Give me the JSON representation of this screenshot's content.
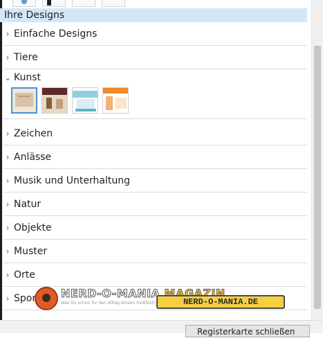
{
  "section": {
    "title": "Ihre Designs"
  },
  "categories": [
    {
      "label": "Einfache Designs"
    },
    {
      "label": "Tiere"
    },
    {
      "label": "Kunst"
    },
    {
      "label": "Zeichen"
    },
    {
      "label": "Anlässe"
    },
    {
      "label": "Musik und Unterhaltung"
    },
    {
      "label": "Natur"
    },
    {
      "label": "Objekte"
    },
    {
      "label": "Muster"
    },
    {
      "label": "Orte"
    },
    {
      "label": "Sport"
    }
  ],
  "kunst_thumbnails": [
    {
      "name": "design-1",
      "colors": [
        "#efe6d8",
        "#d8c2a6"
      ]
    },
    {
      "name": "design-2",
      "colors": [
        "#5b2a2a",
        "#e6d8c6"
      ]
    },
    {
      "name": "design-3",
      "colors": [
        "#8fd0e0",
        "#ffffff"
      ]
    },
    {
      "name": "design-4",
      "colors": [
        "#f08a2a",
        "#ffffff"
      ]
    }
  ],
  "footer": {
    "button_label": "Registerkarte schließen"
  },
  "watermark": {
    "brand_a": "NERD-O-MANIA",
    "brand_b": "MAGAZIN",
    "tagline": "Was Du schon für den Alltag wissen mußtest!",
    "site": "NERD-O-MANIA.DE"
  },
  "colors": {
    "selected_bg": "#d4e7f7",
    "selection_border": "#4a90d9"
  }
}
